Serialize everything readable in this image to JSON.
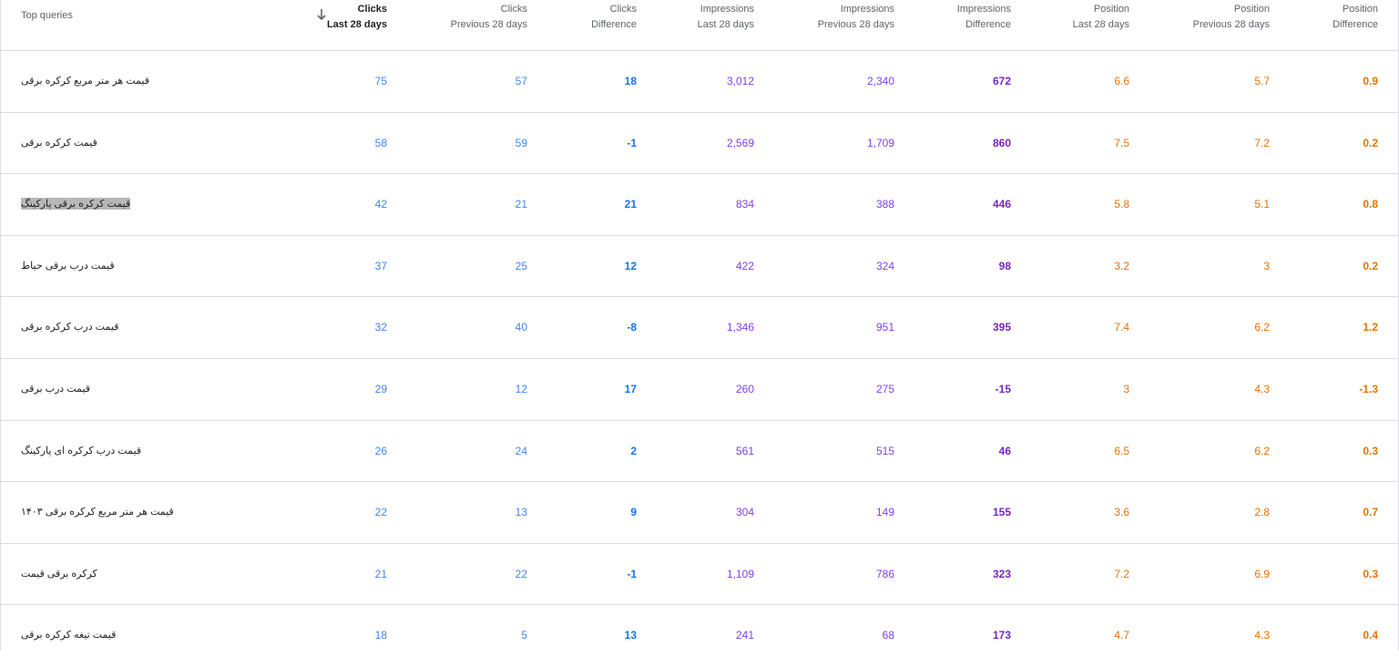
{
  "header": {
    "query_label": "Top queries",
    "columns": [
      {
        "metric": "Clicks",
        "period": "Last 28 days"
      },
      {
        "metric": "Clicks",
        "period": "Previous 28 days"
      },
      {
        "metric": "Clicks",
        "period": "Difference"
      },
      {
        "metric": "Impressions",
        "period": "Last 28 days"
      },
      {
        "metric": "Impressions",
        "period": "Previous 28 days"
      },
      {
        "metric": "Impressions",
        "period": "Difference"
      },
      {
        "metric": "Position",
        "period": "Last 28 days"
      },
      {
        "metric": "Position",
        "period": "Previous 28 days"
      },
      {
        "metric": "Position",
        "period": "Difference"
      }
    ],
    "sort_icon": "arrow-down-icon"
  },
  "rows": [
    {
      "query": "قیمت هر متر مربع کرکره برقی",
      "v": [
        "75",
        "57",
        "18",
        "3,012",
        "2,340",
        "672",
        "6.6",
        "5.7",
        "0.9"
      ]
    },
    {
      "query": "قیمت کرکره برقی",
      "v": [
        "58",
        "59",
        "-1",
        "2,569",
        "1,709",
        "860",
        "7.5",
        "7.2",
        "0.2"
      ]
    },
    {
      "query": "قیمت کرکره برقی پارکینگ",
      "v": [
        "42",
        "21",
        "21",
        "834",
        "388",
        "446",
        "5.8",
        "5.1",
        "0.8"
      ]
    },
    {
      "query": "قیمت درب برقی حیاط",
      "v": [
        "37",
        "25",
        "12",
        "422",
        "324",
        "98",
        "3.2",
        "3",
        "0.2"
      ]
    },
    {
      "query": "قیمت درب کرکره برقی",
      "v": [
        "32",
        "40",
        "-8",
        "1,346",
        "951",
        "395",
        "7.4",
        "6.2",
        "1.2"
      ]
    },
    {
      "query": "قیمت درب برقی",
      "v": [
        "29",
        "12",
        "17",
        "260",
        "275",
        "-15",
        "3",
        "4.3",
        "-1.3"
      ]
    },
    {
      "query": "قیمت درب کرکره ای پارکینگ",
      "v": [
        "26",
        "24",
        "2",
        "561",
        "515",
        "46",
        "6.5",
        "6.2",
        "0.3"
      ]
    },
    {
      "query": "قیمت هر متر مربع کرکره برقی ۱۴۰۳",
      "v": [
        "22",
        "13",
        "9",
        "304",
        "149",
        "155",
        "3.6",
        "2.8",
        "0.7"
      ]
    },
    {
      "query": "کرکره برقی قیمت",
      "v": [
        "21",
        "22",
        "-1",
        "1,109",
        "786",
        "323",
        "7.2",
        "6.9",
        "0.3"
      ]
    },
    {
      "query": "قیمت تیغه کرکره برقی",
      "v": [
        "18",
        "5",
        "13",
        "241",
        "68",
        "173",
        "4.7",
        "4.3",
        "0.4"
      ]
    }
  ],
  "colors": {
    "clicks": "#4285f4",
    "impressions": "#7e3ff2",
    "position": "#e8710a"
  }
}
